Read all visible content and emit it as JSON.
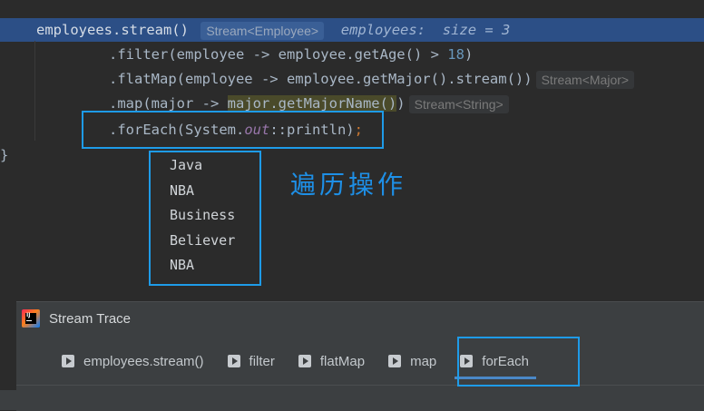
{
  "editor": {
    "line1": {
      "code": "employees.stream()",
      "hint": "Stream<Employee>",
      "debug_var": "employees:",
      "debug_value": "size = 3"
    },
    "line2": {
      "prefix": ".filter(employee -> employee.getAge() > ",
      "number": "18",
      "suffix": ")"
    },
    "line3": {
      "code": ".flatMap(employee -> employee.getMajor().stream())",
      "hint": "Stream<Major>"
    },
    "line4": {
      "prefix": ".map(major -> ",
      "highlighted": "major.getMajorName()",
      "suffix": ")",
      "hint": "Stream<String>"
    },
    "line5": {
      "prefix": ".forEach(System.",
      "field": "out",
      "middle": "::println)",
      "semi": ";"
    },
    "closing_brace": "}"
  },
  "console_output": [
    "Java",
    "NBA",
    "Business",
    "Believer",
    "NBA"
  ],
  "annotation": {
    "text": "遍历操作",
    "color": "#1e8fe6"
  },
  "panel": {
    "title": "Stream Trace",
    "tabs": [
      {
        "label": "employees.stream()",
        "active": false
      },
      {
        "label": "filter",
        "active": false
      },
      {
        "label": "flatMap",
        "active": false
      },
      {
        "label": "map",
        "active": false
      },
      {
        "label": "forEach",
        "active": true
      }
    ]
  },
  "colors": {
    "current_line": "#2c4f86",
    "annotation_border": "#1e9be8",
    "active_tab_underline": "#4a88c7"
  }
}
